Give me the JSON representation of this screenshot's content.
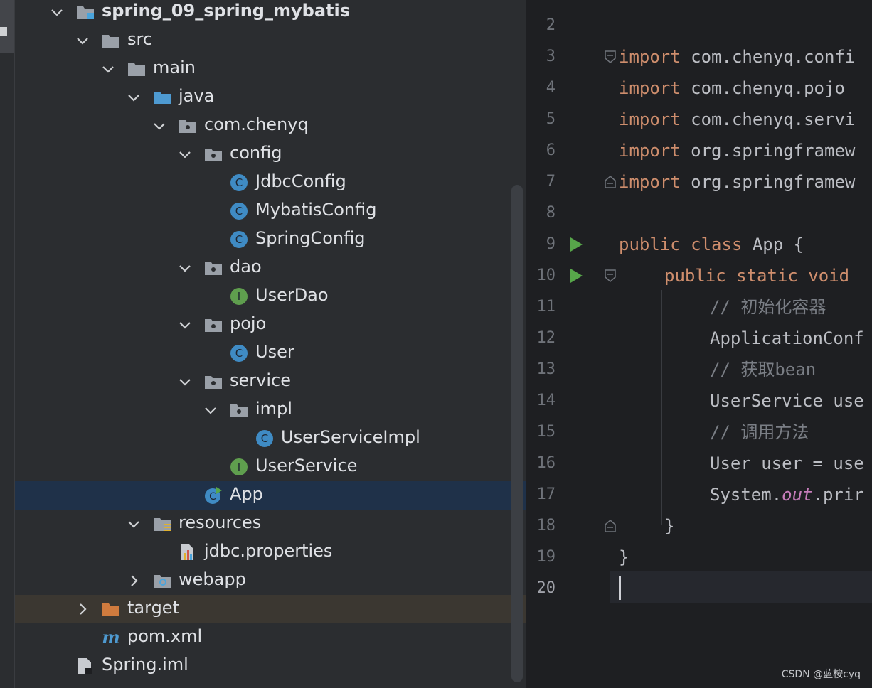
{
  "project_tree": [
    {
      "label": "spring_09_spring_mybatis",
      "depth": 0,
      "bold": true,
      "expanded": true,
      "icon": "module-folder-icon"
    },
    {
      "label": "src",
      "depth": 1,
      "expanded": true,
      "icon": "folder-icon"
    },
    {
      "label": "main",
      "depth": 2,
      "expanded": true,
      "icon": "folder-icon"
    },
    {
      "label": "java",
      "depth": 3,
      "expanded": true,
      "icon": "source-root-folder-icon"
    },
    {
      "label": "com.chenyq",
      "depth": 4,
      "expanded": true,
      "icon": "package-icon"
    },
    {
      "label": "config",
      "depth": 5,
      "expanded": true,
      "icon": "package-icon"
    },
    {
      "label": "JdbcConfig",
      "depth": 6,
      "icon": "class-icon"
    },
    {
      "label": "MybatisConfig",
      "depth": 6,
      "icon": "class-icon"
    },
    {
      "label": "SpringConfig",
      "depth": 6,
      "icon": "class-icon"
    },
    {
      "label": "dao",
      "depth": 5,
      "expanded": true,
      "icon": "package-icon"
    },
    {
      "label": "UserDao",
      "depth": 6,
      "icon": "interface-icon"
    },
    {
      "label": "pojo",
      "depth": 5,
      "expanded": true,
      "icon": "package-icon"
    },
    {
      "label": "User",
      "depth": 6,
      "icon": "class-icon"
    },
    {
      "label": "service",
      "depth": 5,
      "expanded": true,
      "icon": "package-icon"
    },
    {
      "label": "impl",
      "depth": 6,
      "expanded": true,
      "icon": "package-icon"
    },
    {
      "label": "UserServiceImpl",
      "depth": 7,
      "icon": "class-icon"
    },
    {
      "label": "UserService",
      "depth": 6,
      "icon": "interface-icon"
    },
    {
      "label": "App",
      "depth": 5,
      "icon": "runnable-class-icon",
      "selected": true
    },
    {
      "label": "resources",
      "depth": 3,
      "expanded": true,
      "icon": "resources-folder-icon"
    },
    {
      "label": "jdbc.properties",
      "depth": 4,
      "icon": "properties-file-icon"
    },
    {
      "label": "webapp",
      "depth": 3,
      "expanded": false,
      "icon": "web-folder-icon"
    },
    {
      "label": "target",
      "depth": 1,
      "expanded": false,
      "icon": "excluded-folder-icon",
      "excluded": true
    },
    {
      "label": "pom.xml",
      "depth": 1,
      "icon": "maven-icon"
    },
    {
      "label": "Spring.iml",
      "depth": 0,
      "icon": "iml-file-icon"
    }
  ],
  "editor": {
    "line_numbers": [
      "2",
      "3",
      "4",
      "5",
      "6",
      "7",
      "8",
      "9",
      "10",
      "11",
      "12",
      "13",
      "14",
      "15",
      "16",
      "17",
      "18",
      "19",
      "20"
    ],
    "current_line": "20",
    "lines": [
      {
        "n": "3",
        "k": "import",
        "t": " com.chenyq.confi"
      },
      {
        "n": "4",
        "k": "import",
        "t": " com.chenyq.pojo"
      },
      {
        "n": "5",
        "k": "import",
        "t": " com.chenyq.servi"
      },
      {
        "n": "6",
        "k": "import",
        "t": " org.springframew"
      },
      {
        "n": "7",
        "k": "import",
        "t": " org.springframew"
      },
      {
        "n": "9",
        "k": "public class",
        "t": " App {"
      },
      {
        "n": "10",
        "k": "public static void",
        "t": ""
      },
      {
        "n": "11",
        "c": "// 初始化容器"
      },
      {
        "n": "12",
        "t": "ApplicationConf"
      },
      {
        "n": "13",
        "c": "// 获取bean"
      },
      {
        "n": "14",
        "t": "UserService use"
      },
      {
        "n": "15",
        "c": "// 调用方法"
      },
      {
        "n": "16",
        "t": "User user = use"
      },
      {
        "n": "17",
        "t": "System.",
        "s": "out",
        "t2": ".prir"
      },
      {
        "n": "18",
        "t": "}"
      },
      {
        "n": "19",
        "t": "}"
      }
    ]
  },
  "watermark": "CSDN @蓝桉cyq",
  "colors": {
    "selection": "#1f3149",
    "excluded_row": "#3b3731",
    "keyword": "#cf8e6d",
    "comment": "#7a7e85",
    "run_icon": "#57a64a"
  }
}
